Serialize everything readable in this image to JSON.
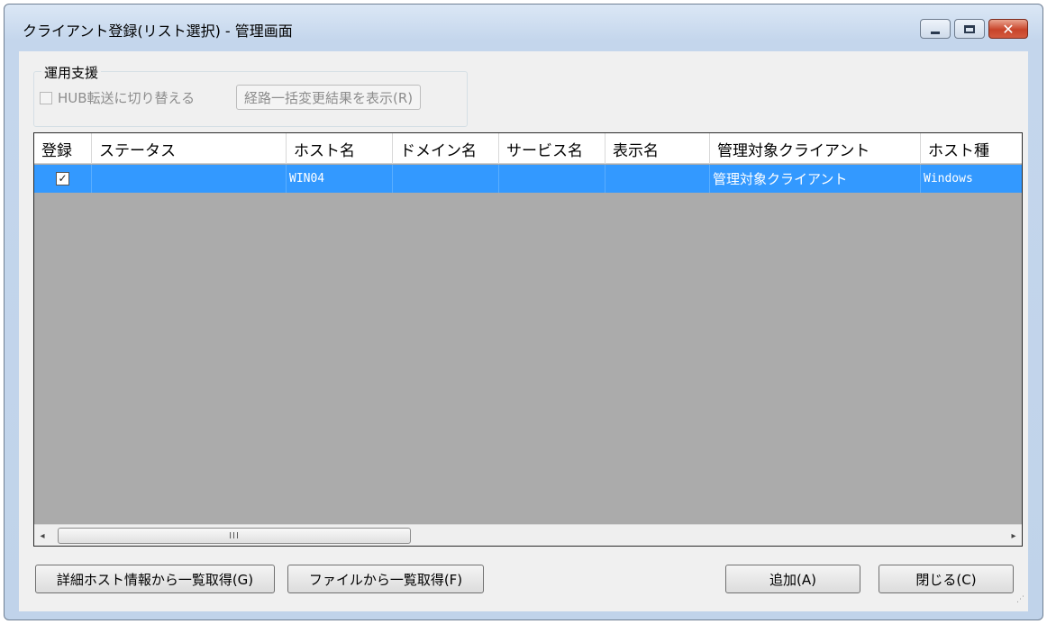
{
  "window": {
    "title": "クライアント登録(リスト選択) - 管理画面"
  },
  "ops_group": {
    "title": "運用支援",
    "hub_checkbox_label": "HUB転送に切り替える",
    "route_button_label": "経路一括変更結果を表示(R)"
  },
  "grid": {
    "columns": [
      "登録",
      "ステータス",
      "ホスト名",
      "ドメイン名",
      "サービス名",
      "表示名",
      "管理対象クライアント",
      "ホスト種"
    ],
    "rows": [
      {
        "registered": "✓",
        "status": "",
        "host": "WIN04",
        "domain": "",
        "service": "",
        "display": "",
        "managed_client": "管理対象クライアント",
        "host_type": "Windows"
      }
    ]
  },
  "buttons": {
    "detail_host": "詳細ホスト情報から一覧取得(G)",
    "from_file": "ファイルから一覧取得(F)",
    "add": "追加(A)",
    "close": "閉じる(C)"
  },
  "scrollbar": {
    "left_arrow": "◂",
    "right_arrow": "▸",
    "grip": "III"
  },
  "colors": {
    "selection": "#3399ff",
    "grid_empty": "#ababab"
  }
}
